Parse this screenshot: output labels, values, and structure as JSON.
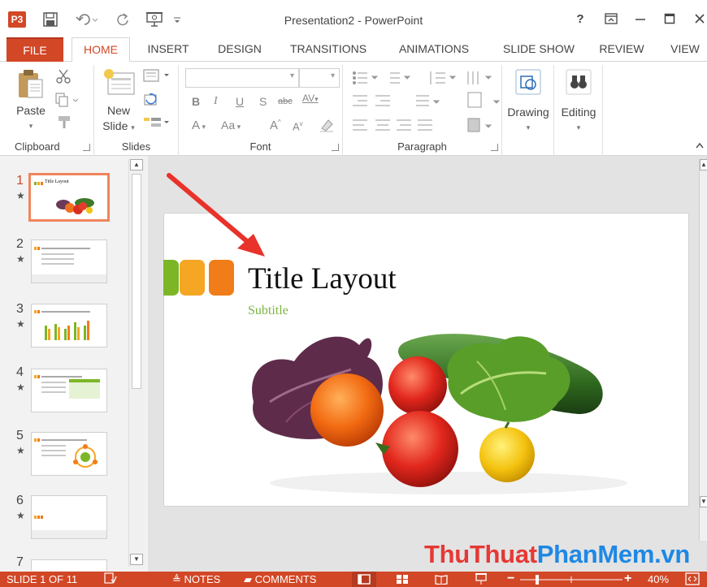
{
  "titlebar": {
    "app_icon_label": "P3",
    "window_title": "Presentation2 - PowerPoint",
    "help_label": "?",
    "icons": [
      "save-icon",
      "undo-icon",
      "redo-icon",
      "present-from-beginning-icon",
      "customize-qat-icon",
      "help-icon",
      "ribbon-display-options-icon",
      "minimize-icon",
      "maximize-icon",
      "close-icon"
    ]
  },
  "tabs": [
    {
      "label": "FILE",
      "active": false
    },
    {
      "label": "HOME",
      "active": true
    },
    {
      "label": "INSERT",
      "active": false
    },
    {
      "label": "DESIGN",
      "active": false
    },
    {
      "label": "TRANSITIONS",
      "active": false
    },
    {
      "label": "ANIMATIONS",
      "active": false
    },
    {
      "label": "SLIDE SHOW",
      "active": false
    },
    {
      "label": "REVIEW",
      "active": false
    },
    {
      "label": "VIEW",
      "active": false
    }
  ],
  "ribbon": {
    "clipboard": {
      "paste_label": "Paste",
      "group_label": "Clipboard"
    },
    "slides": {
      "new_slide_line1": "New",
      "new_slide_line2": "Slide",
      "group_label": "Slides"
    },
    "font": {
      "group_label": "Font",
      "font_name_value": "",
      "font_size_value": "",
      "buttons": [
        "B",
        "I",
        "U",
        "S",
        "abc",
        "AV",
        "A",
        "Aa",
        "A",
        "A"
      ]
    },
    "paragraph": {
      "group_label": "Paragraph"
    },
    "drawing": {
      "label": "Drawing"
    },
    "editing": {
      "label": "Editing"
    }
  },
  "thumbnails": [
    {
      "number": "1",
      "title": "Title Layout",
      "selected": true
    },
    {
      "number": "2",
      "title": "",
      "selected": false
    },
    {
      "number": "3",
      "title": "",
      "selected": false
    },
    {
      "number": "4",
      "title": "",
      "selected": false
    },
    {
      "number": "5",
      "title": "",
      "selected": false
    },
    {
      "number": "6",
      "title": "",
      "selected": false
    },
    {
      "number": "7",
      "title": "",
      "selected": false
    }
  ],
  "slide": {
    "title": "Title Layout",
    "subtitle": "Subtitle",
    "accent_colors": [
      "#7cb626",
      "#f5a623",
      "#f07d1a"
    ],
    "image": "vegetables-photo"
  },
  "statusbar": {
    "slide_indicator": "SLIDE 1 OF 11",
    "notes_label": "NOTES",
    "comments_label": "COMMENTS",
    "zoom_level": "40%",
    "zoom_fraction": 0.4
  },
  "watermark": {
    "part1": "ThuThuat",
    "part2": "PhanMem",
    "part3": ".vn"
  },
  "colors": {
    "accent": "#d24726",
    "subtitle": "#7cb342",
    "annotation_arrow": "#e8322a"
  }
}
